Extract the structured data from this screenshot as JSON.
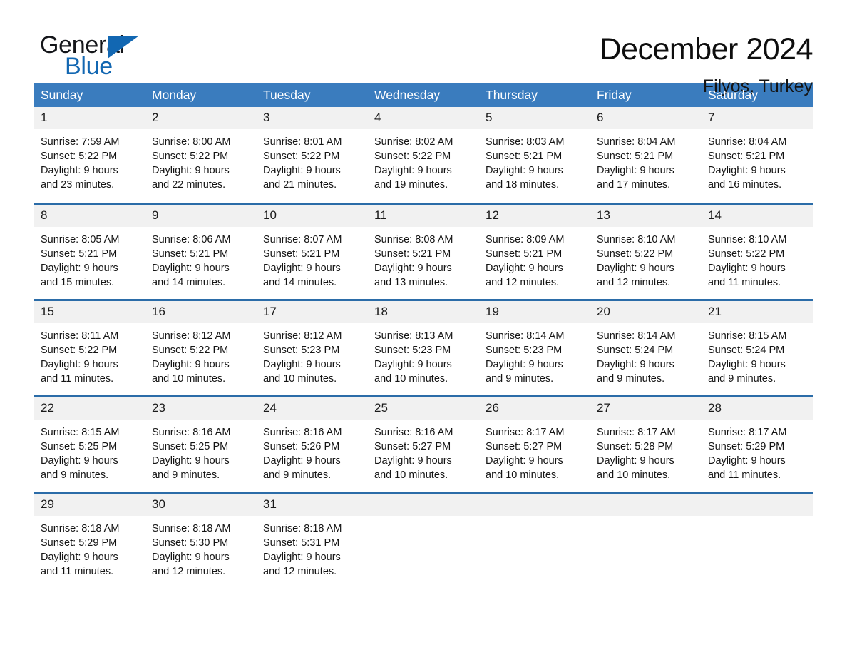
{
  "brand": {
    "name_top": "General",
    "name_bottom": "Blue",
    "accent_color": "#1267b2"
  },
  "header": {
    "title": "December 2024",
    "subtitle": "Filyos, Turkey"
  },
  "theme": {
    "header_row_bg": "#3a7cbe",
    "row_divider": "#2b6ca8",
    "daynum_bg": "#f1f1f1"
  },
  "calendar": {
    "weekdays": [
      "Sunday",
      "Monday",
      "Tuesday",
      "Wednesday",
      "Thursday",
      "Friday",
      "Saturday"
    ],
    "weeks": [
      [
        {
          "day": "1",
          "sunrise": "Sunrise: 7:59 AM",
          "sunset": "Sunset: 5:22 PM",
          "daylight_1": "Daylight: 9 hours",
          "daylight_2": "and 23 minutes."
        },
        {
          "day": "2",
          "sunrise": "Sunrise: 8:00 AM",
          "sunset": "Sunset: 5:22 PM",
          "daylight_1": "Daylight: 9 hours",
          "daylight_2": "and 22 minutes."
        },
        {
          "day": "3",
          "sunrise": "Sunrise: 8:01 AM",
          "sunset": "Sunset: 5:22 PM",
          "daylight_1": "Daylight: 9 hours",
          "daylight_2": "and 21 minutes."
        },
        {
          "day": "4",
          "sunrise": "Sunrise: 8:02 AM",
          "sunset": "Sunset: 5:22 PM",
          "daylight_1": "Daylight: 9 hours",
          "daylight_2": "and 19 minutes."
        },
        {
          "day": "5",
          "sunrise": "Sunrise: 8:03 AM",
          "sunset": "Sunset: 5:21 PM",
          "daylight_1": "Daylight: 9 hours",
          "daylight_2": "and 18 minutes."
        },
        {
          "day": "6",
          "sunrise": "Sunrise: 8:04 AM",
          "sunset": "Sunset: 5:21 PM",
          "daylight_1": "Daylight: 9 hours",
          "daylight_2": "and 17 minutes."
        },
        {
          "day": "7",
          "sunrise": "Sunrise: 8:04 AM",
          "sunset": "Sunset: 5:21 PM",
          "daylight_1": "Daylight: 9 hours",
          "daylight_2": "and 16 minutes."
        }
      ],
      [
        {
          "day": "8",
          "sunrise": "Sunrise: 8:05 AM",
          "sunset": "Sunset: 5:21 PM",
          "daylight_1": "Daylight: 9 hours",
          "daylight_2": "and 15 minutes."
        },
        {
          "day": "9",
          "sunrise": "Sunrise: 8:06 AM",
          "sunset": "Sunset: 5:21 PM",
          "daylight_1": "Daylight: 9 hours",
          "daylight_2": "and 14 minutes."
        },
        {
          "day": "10",
          "sunrise": "Sunrise: 8:07 AM",
          "sunset": "Sunset: 5:21 PM",
          "daylight_1": "Daylight: 9 hours",
          "daylight_2": "and 14 minutes."
        },
        {
          "day": "11",
          "sunrise": "Sunrise: 8:08 AM",
          "sunset": "Sunset: 5:21 PM",
          "daylight_1": "Daylight: 9 hours",
          "daylight_2": "and 13 minutes."
        },
        {
          "day": "12",
          "sunrise": "Sunrise: 8:09 AM",
          "sunset": "Sunset: 5:21 PM",
          "daylight_1": "Daylight: 9 hours",
          "daylight_2": "and 12 minutes."
        },
        {
          "day": "13",
          "sunrise": "Sunrise: 8:10 AM",
          "sunset": "Sunset: 5:22 PM",
          "daylight_1": "Daylight: 9 hours",
          "daylight_2": "and 12 minutes."
        },
        {
          "day": "14",
          "sunrise": "Sunrise: 8:10 AM",
          "sunset": "Sunset: 5:22 PM",
          "daylight_1": "Daylight: 9 hours",
          "daylight_2": "and 11 minutes."
        }
      ],
      [
        {
          "day": "15",
          "sunrise": "Sunrise: 8:11 AM",
          "sunset": "Sunset: 5:22 PM",
          "daylight_1": "Daylight: 9 hours",
          "daylight_2": "and 11 minutes."
        },
        {
          "day": "16",
          "sunrise": "Sunrise: 8:12 AM",
          "sunset": "Sunset: 5:22 PM",
          "daylight_1": "Daylight: 9 hours",
          "daylight_2": "and 10 minutes."
        },
        {
          "day": "17",
          "sunrise": "Sunrise: 8:12 AM",
          "sunset": "Sunset: 5:23 PM",
          "daylight_1": "Daylight: 9 hours",
          "daylight_2": "and 10 minutes."
        },
        {
          "day": "18",
          "sunrise": "Sunrise: 8:13 AM",
          "sunset": "Sunset: 5:23 PM",
          "daylight_1": "Daylight: 9 hours",
          "daylight_2": "and 10 minutes."
        },
        {
          "day": "19",
          "sunrise": "Sunrise: 8:14 AM",
          "sunset": "Sunset: 5:23 PM",
          "daylight_1": "Daylight: 9 hours",
          "daylight_2": "and 9 minutes."
        },
        {
          "day": "20",
          "sunrise": "Sunrise: 8:14 AM",
          "sunset": "Sunset: 5:24 PM",
          "daylight_1": "Daylight: 9 hours",
          "daylight_2": "and 9 minutes."
        },
        {
          "day": "21",
          "sunrise": "Sunrise: 8:15 AM",
          "sunset": "Sunset: 5:24 PM",
          "daylight_1": "Daylight: 9 hours",
          "daylight_2": "and 9 minutes."
        }
      ],
      [
        {
          "day": "22",
          "sunrise": "Sunrise: 8:15 AM",
          "sunset": "Sunset: 5:25 PM",
          "daylight_1": "Daylight: 9 hours",
          "daylight_2": "and 9 minutes."
        },
        {
          "day": "23",
          "sunrise": "Sunrise: 8:16 AM",
          "sunset": "Sunset: 5:25 PM",
          "daylight_1": "Daylight: 9 hours",
          "daylight_2": "and 9 minutes."
        },
        {
          "day": "24",
          "sunrise": "Sunrise: 8:16 AM",
          "sunset": "Sunset: 5:26 PM",
          "daylight_1": "Daylight: 9 hours",
          "daylight_2": "and 9 minutes."
        },
        {
          "day": "25",
          "sunrise": "Sunrise: 8:16 AM",
          "sunset": "Sunset: 5:27 PM",
          "daylight_1": "Daylight: 9 hours",
          "daylight_2": "and 10 minutes."
        },
        {
          "day": "26",
          "sunrise": "Sunrise: 8:17 AM",
          "sunset": "Sunset: 5:27 PM",
          "daylight_1": "Daylight: 9 hours",
          "daylight_2": "and 10 minutes."
        },
        {
          "day": "27",
          "sunrise": "Sunrise: 8:17 AM",
          "sunset": "Sunset: 5:28 PM",
          "daylight_1": "Daylight: 9 hours",
          "daylight_2": "and 10 minutes."
        },
        {
          "day": "28",
          "sunrise": "Sunrise: 8:17 AM",
          "sunset": "Sunset: 5:29 PM",
          "daylight_1": "Daylight: 9 hours",
          "daylight_2": "and 11 minutes."
        }
      ],
      [
        {
          "day": "29",
          "sunrise": "Sunrise: 8:18 AM",
          "sunset": "Sunset: 5:29 PM",
          "daylight_1": "Daylight: 9 hours",
          "daylight_2": "and 11 minutes."
        },
        {
          "day": "30",
          "sunrise": "Sunrise: 8:18 AM",
          "sunset": "Sunset: 5:30 PM",
          "daylight_1": "Daylight: 9 hours",
          "daylight_2": "and 12 minutes."
        },
        {
          "day": "31",
          "sunrise": "Sunrise: 8:18 AM",
          "sunset": "Sunset: 5:31 PM",
          "daylight_1": "Daylight: 9 hours",
          "daylight_2": "and 12 minutes."
        },
        {
          "day": "",
          "sunrise": "",
          "sunset": "",
          "daylight_1": "",
          "daylight_2": ""
        },
        {
          "day": "",
          "sunrise": "",
          "sunset": "",
          "daylight_1": "",
          "daylight_2": ""
        },
        {
          "day": "",
          "sunrise": "",
          "sunset": "",
          "daylight_1": "",
          "daylight_2": ""
        },
        {
          "day": "",
          "sunrise": "",
          "sunset": "",
          "daylight_1": "",
          "daylight_2": ""
        }
      ]
    ]
  }
}
